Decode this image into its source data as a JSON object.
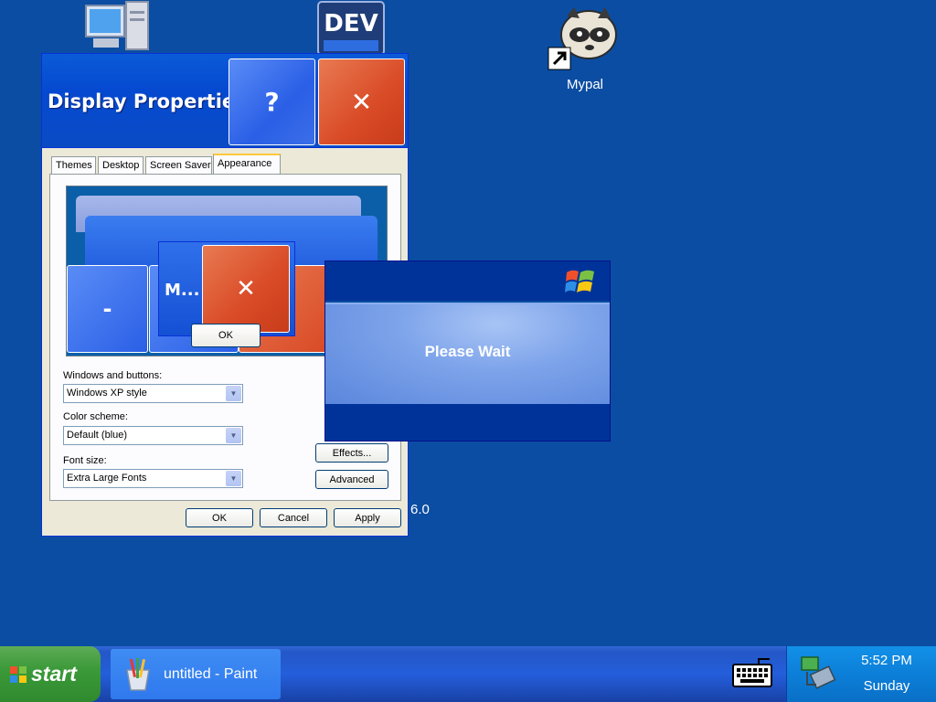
{
  "desktop": {
    "icons": [
      {
        "name": "My Computer",
        "label": ""
      },
      {
        "name": "DEV",
        "label": ""
      },
      {
        "name": "Mypal",
        "label": "Mypal"
      }
    ],
    "dev_icon_text": "DEV",
    "stray_text": "6.0"
  },
  "display_properties": {
    "title": "Display Properties",
    "help_glyph": "?",
    "close_glyph": "✕",
    "tabs": [
      "Themes",
      "Desktop",
      "Screen Saver",
      "Appearance"
    ],
    "active_tab": "Appearance",
    "preview": {
      "min_glyph": "-",
      "message_title": "M...",
      "close_glyph": "✕",
      "ok_label": "OK"
    },
    "windows_and_buttons": {
      "label": "Windows and buttons:",
      "value": "Windows XP style"
    },
    "color_scheme": {
      "label": "Color scheme:",
      "value": "Default (blue)"
    },
    "font_size": {
      "label": "Font size:",
      "value": "Extra Large Fonts"
    },
    "effects_label": "Effects...",
    "advanced_label": "Advanced",
    "ok_label": "OK",
    "cancel_label": "Cancel",
    "apply_label": "Apply"
  },
  "please_wait": {
    "text": "Please Wait"
  },
  "taskbar": {
    "start_label": "start",
    "task_label": "untitled - Paint",
    "clock_time": "5:52 PM",
    "clock_day": "Sunday"
  },
  "colors": {
    "desktop": "#0b4da2",
    "title_blue": "#0549d0",
    "close_red": "#d94a26",
    "start_green": "#3c9a3a"
  }
}
